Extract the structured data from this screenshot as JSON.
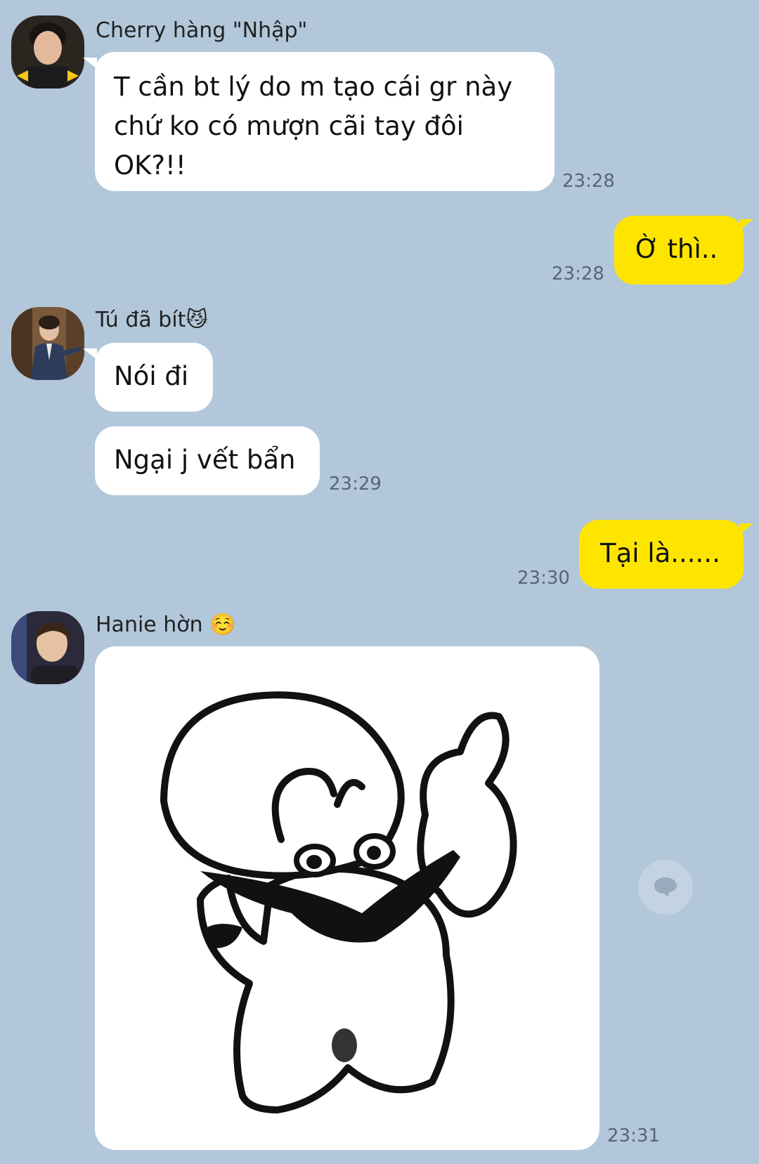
{
  "colors": {
    "background": "#b2c7da",
    "incoming_bubble": "#ffffff",
    "outgoing_bubble": "#fee500",
    "timestamp": "#556677"
  },
  "messages": [
    {
      "sender": "Cherry hàng \"Nhập\"",
      "avatar_icon": "profile-photo-thumbs-up",
      "lines": [
        "T cần bt lý do m tạo cái gr này",
        "chứ ko có mượn cãi tay đôi",
        "OK?!!"
      ],
      "time": "23:28"
    },
    {
      "outgoing": true,
      "text": "Ờ thì..",
      "time": "23:28"
    },
    {
      "sender": "Tú đã bít",
      "sender_emoji": "😼",
      "avatar_icon": "profile-photo-school-uniform",
      "bubbles": [
        "Nói đi",
        "Ngại j vết bẩn"
      ],
      "time": "23:29"
    },
    {
      "outgoing": true,
      "text": "Tại là......",
      "time": "23:30"
    },
    {
      "sender": "Hanie hờn",
      "sender_emoji": "☺️",
      "avatar_icon": "profile-photo-portrait",
      "sticker_icon": "thumbs-up-cartoon-sticker",
      "time": "23:31"
    }
  ],
  "reply_button_icon": "chat-bubble-icon"
}
